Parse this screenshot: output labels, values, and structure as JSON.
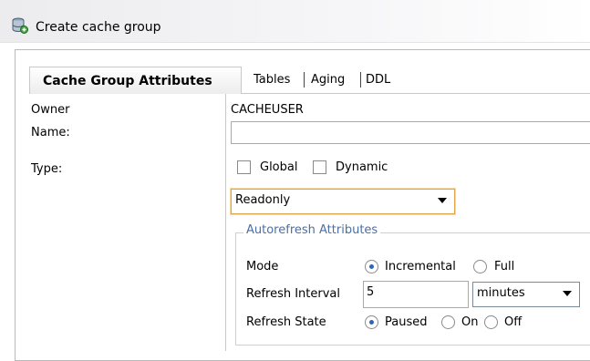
{
  "window": {
    "title": "Create cache group",
    "icon": "database-cache-icon"
  },
  "tabs": [
    {
      "label": "Cache Group Attributes",
      "active": true
    },
    {
      "label": "Tables",
      "active": false
    },
    {
      "label": "Aging",
      "active": false
    },
    {
      "label": "DDL",
      "active": false
    }
  ],
  "form": {
    "owner_label": "Owner",
    "owner_value": "CACHEUSER",
    "name_label": "Name:",
    "name_value": "",
    "type_label": "Type:",
    "global_label": "Global",
    "global_checked": false,
    "dynamic_label": "Dynamic",
    "dynamic_checked": false,
    "type_select_value": "Readonly"
  },
  "autorefresh": {
    "legend": "Autorefresh Attributes",
    "mode_label": "Mode",
    "mode_options": [
      "Incremental",
      "Full"
    ],
    "mode_selected": "Incremental",
    "interval_label": "Refresh Interval",
    "interval_value": "5",
    "interval_unit": "minutes",
    "state_label": "Refresh State",
    "state_options": [
      "Paused",
      "On",
      "Off"
    ],
    "state_selected": "Paused"
  },
  "colors": {
    "legend_text": "#4a6fa5",
    "radio_dot": "#2f64b6",
    "focus_border": "#e0a64a"
  }
}
